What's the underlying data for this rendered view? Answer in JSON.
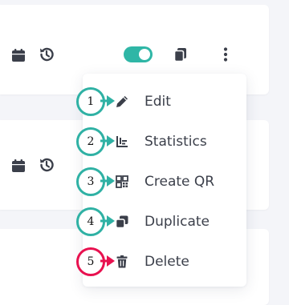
{
  "colors": {
    "background": "#f4f5f9",
    "card": "#ffffff",
    "icon": "#3b3f4a",
    "toggle_on": "#2fb6a6",
    "callout_teal": "#2fb1a4",
    "callout_red": "#e8114f"
  },
  "cards": [
    {
      "icons": [
        "calendar-icon",
        "history-icon"
      ],
      "actions": [
        "status-toggle",
        "copy-icon",
        "more-vertical-icon"
      ],
      "toggle_on": true
    },
    {
      "icons": [
        "calendar-icon",
        "history-icon"
      ]
    },
    {}
  ],
  "menu": {
    "items": [
      {
        "label": "Edit",
        "icon": "pencil-icon",
        "callout": "1",
        "callout_color": "teal"
      },
      {
        "label": "Statistics",
        "icon": "bar-chart-icon",
        "callout": "2",
        "callout_color": "teal"
      },
      {
        "label": "Create QR",
        "icon": "qr-code-icon",
        "callout": "3",
        "callout_color": "teal"
      },
      {
        "label": "Duplicate",
        "icon": "duplicate-icon",
        "callout": "4",
        "callout_color": "teal"
      },
      {
        "label": "Delete",
        "icon": "trash-icon",
        "callout": "5",
        "callout_color": "red"
      }
    ]
  }
}
